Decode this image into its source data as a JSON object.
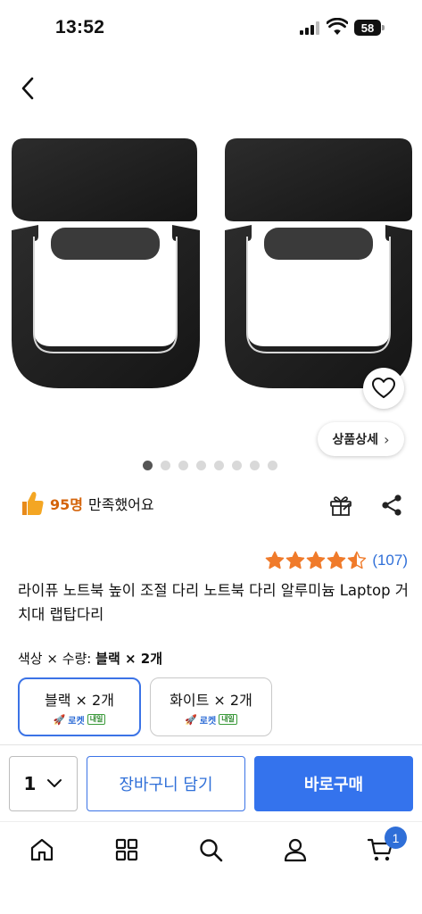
{
  "status_bar": {
    "time": "13:52",
    "battery": "58"
  },
  "product": {
    "detail_button_label": "상품상세",
    "image_count": 8,
    "active_image_index": 0,
    "satisfaction_count": "95명",
    "satisfaction_text": "만족했어요",
    "rating": 4.5,
    "review_count": "(107)",
    "title": "라이퓨 노트북 높이 조절 다리 노트북 다리 알루미늄 Laptop 거치대 랩탑다리"
  },
  "option": {
    "label_prefix": "색상 × 수량: ",
    "label_value": "블랙 × 2개",
    "choices": [
      {
        "name": "블랙 × 2개",
        "rocket": "로켓",
        "badge": "내일",
        "selected": true
      },
      {
        "name": "화이트 × 2개",
        "rocket": "로켓",
        "badge": "내일",
        "selected": false
      }
    ]
  },
  "actions": {
    "quantity": "1",
    "cart_label": "장바구니 담기",
    "buy_label": "바로구매"
  },
  "tabbar": {
    "items": [
      "home-icon",
      "category-grid-icon",
      "search-icon",
      "user-icon",
      "cart-icon"
    ],
    "cart_badge": "1"
  },
  "colors": {
    "accent": "#3473ed",
    "star": "#f07b2b",
    "satisfaction": "#d4630a"
  }
}
